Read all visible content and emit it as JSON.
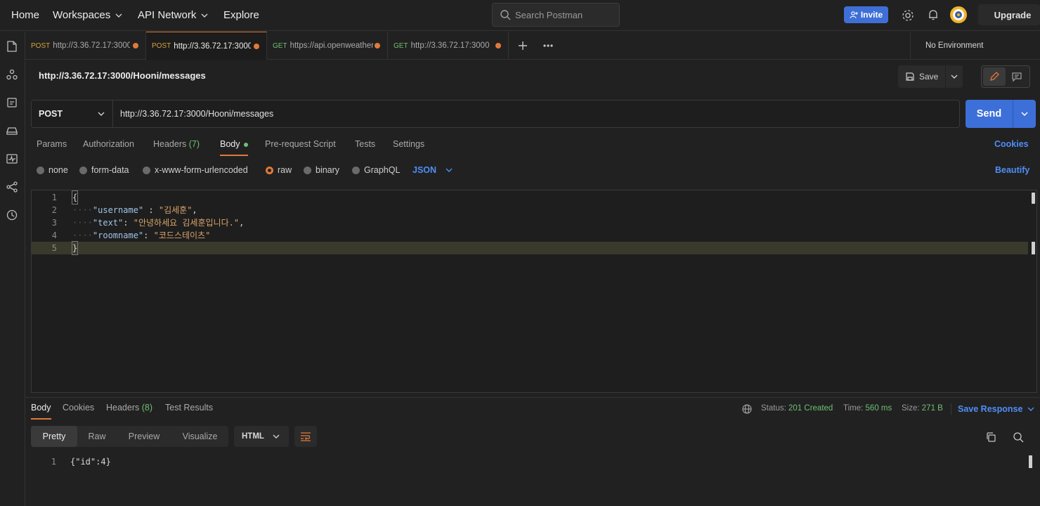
{
  "topbar": {
    "home": "Home",
    "workspaces": "Workspaces",
    "api_network": "API Network",
    "explore": "Explore",
    "search_placeholder": "Search Postman",
    "invite": "Invite",
    "upgrade": "Upgrade"
  },
  "tabs": [
    {
      "method": "POST",
      "url": "http://3.36.72.17:3000",
      "method_color": "#d8a23a"
    },
    {
      "method": "POST",
      "url": "http://3.36.72.17:3000",
      "method_color": "#d8a23a"
    },
    {
      "method": "GET",
      "url": "https://api.openweather",
      "method_color": "#6fbf73"
    },
    {
      "method": "GET",
      "url": "http://3.36.72.17:3000",
      "method_color": "#6fbf73"
    }
  ],
  "environment": "No Environment",
  "request": {
    "title": "http://3.36.72.17:3000/Hooni/messages",
    "save": "Save",
    "method": "POST",
    "url": "http://3.36.72.17:3000/Hooni/messages",
    "send": "Send"
  },
  "request_tabs": {
    "params": "Params",
    "authorization": "Authorization",
    "headers": "Headers",
    "headers_count": "(7)",
    "body": "Body",
    "pre_request": "Pre-request Script",
    "tests": "Tests",
    "settings": "Settings",
    "cookies": "Cookies"
  },
  "body_types": {
    "none": "none",
    "form_data": "form-data",
    "urlencoded": "x-www-form-urlencoded",
    "raw": "raw",
    "binary": "binary",
    "graphql": "GraphQL",
    "format": "JSON",
    "beautify": "Beautify"
  },
  "editor": {
    "line_numbers": [
      "1",
      "2",
      "3",
      "4",
      "5"
    ],
    "open_brace": "{",
    "close_brace": "}",
    "indent": "····",
    "key_username": "\"username\"",
    "sep_username": " : ",
    "val_username": "\"김세훈\"",
    "key_text": "\"text\"",
    "sep_text": ": ",
    "val_text": "\"안녕하세요 김세훈입니다.\"",
    "key_roomname": "\"roomname\"",
    "sep_roomname": ": ",
    "val_roomname": "\"코드스테이츠\"",
    "comma": ","
  },
  "response": {
    "tabs": {
      "body": "Body",
      "cookies": "Cookies",
      "headers": "Headers",
      "headers_count": "(8)",
      "test_results": "Test Results"
    },
    "status_label": "Status:",
    "status_value": "201 Created",
    "time_label": "Time:",
    "time_value": "560 ms",
    "size_label": "Size:",
    "size_value": "271 B",
    "save_response": "Save Response",
    "views": {
      "pretty": "Pretty",
      "raw": "Raw",
      "preview": "Preview",
      "visualize": "Visualize"
    },
    "format": "HTML",
    "line_number": "1",
    "content": "{\"id\":4}"
  }
}
